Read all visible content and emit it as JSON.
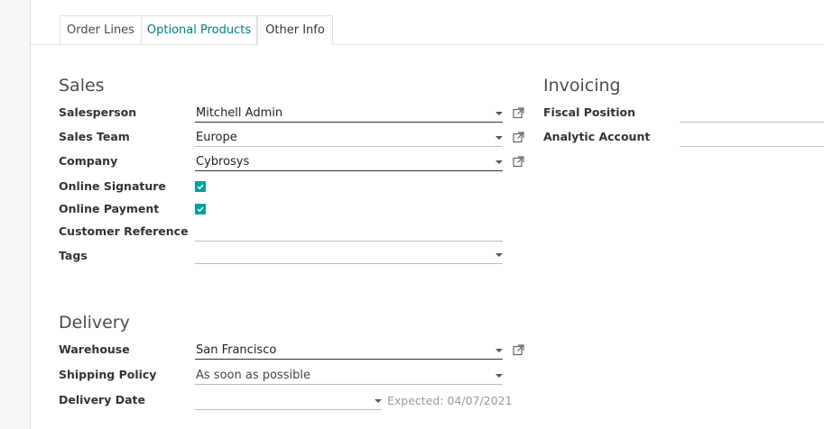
{
  "tabs": [
    {
      "label": "Order Lines"
    },
    {
      "label": "Optional Products"
    },
    {
      "label": "Other Info"
    }
  ],
  "sales": {
    "title": "Sales",
    "salesperson_label": "Salesperson",
    "salesperson_value": "Mitchell Admin",
    "sales_team_label": "Sales Team",
    "sales_team_value": "Europe",
    "company_label": "Company",
    "company_value": "Cybrosys",
    "online_signature_label": "Online Signature",
    "online_signature_checked": true,
    "online_payment_label": "Online Payment",
    "online_payment_checked": true,
    "customer_reference_label": "Customer Reference",
    "customer_reference_value": "",
    "tags_label": "Tags",
    "tags_value": ""
  },
  "invoicing": {
    "title": "Invoicing",
    "fiscal_position_label": "Fiscal Position",
    "fiscal_position_value": "",
    "analytic_account_label": "Analytic Account",
    "analytic_account_value": ""
  },
  "delivery": {
    "title": "Delivery",
    "warehouse_label": "Warehouse",
    "warehouse_value": "San Francisco",
    "shipping_policy_label": "Shipping Policy",
    "shipping_policy_value": "As soon as possible",
    "delivery_date_label": "Delivery Date",
    "delivery_date_value": "",
    "expected_text": "Expected: 04/07/2021"
  },
  "colors": {
    "accent": "#01a09d",
    "tab_link": "#017e84"
  },
  "icons": {
    "external_link": "external-link-icon",
    "dropdown": "chevron-down-icon",
    "check": "check-icon"
  }
}
